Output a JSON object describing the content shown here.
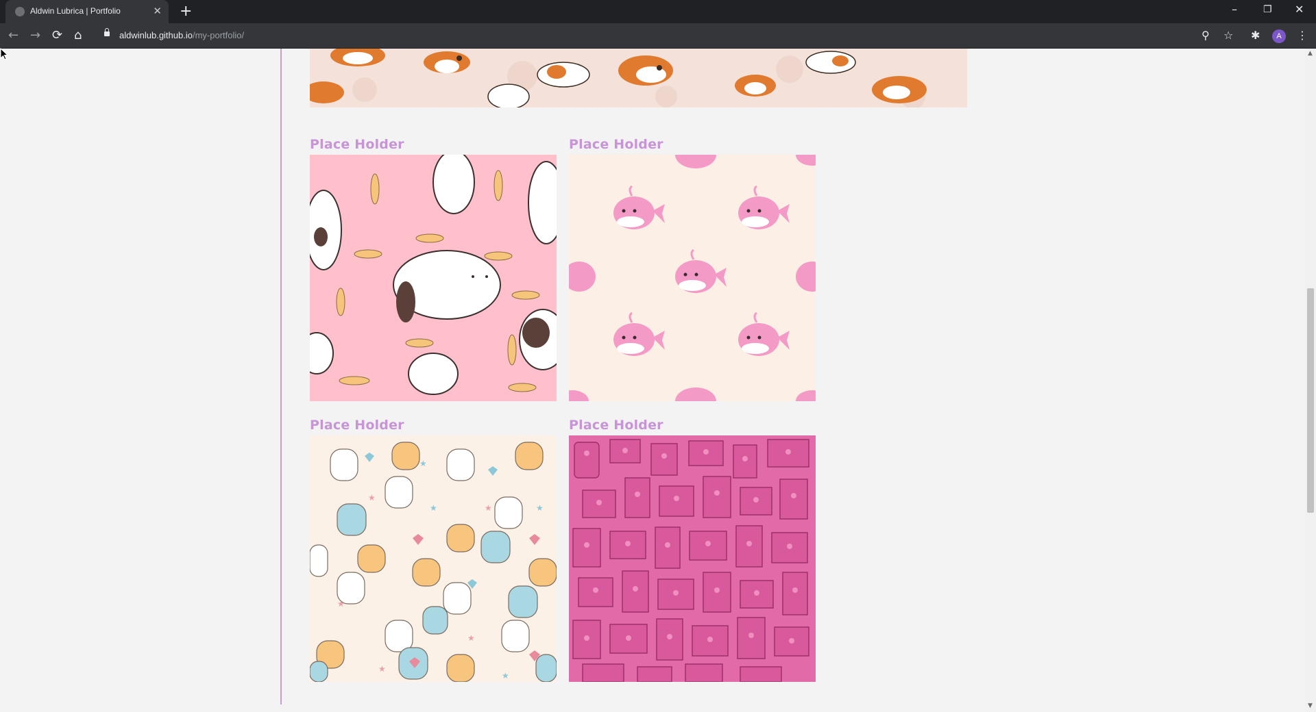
{
  "browser": {
    "tab_title": "Aldwin Lubrica | Portfolio",
    "tab_close": "✕",
    "new_tab": "+",
    "url_host": "aldwinlub.github.io",
    "url_path": "/my-portfolio/",
    "avatar_letter": "A",
    "icons": {
      "back": "←",
      "forward": "→",
      "reload": "⟳",
      "home": "⌂",
      "zoom": "⚲",
      "star": "☆",
      "extensions": "✱",
      "menu": "⋮",
      "minimize": "–",
      "restore": "❐",
      "close": "✕"
    }
  },
  "gallery": {
    "items": [
      {
        "caption": "Place Holder",
        "pattern": "cats-fish-on-pink"
      },
      {
        "caption": "Place Holder",
        "pattern": "pink-whales-on-cream"
      },
      {
        "caption": "Place Holder",
        "pattern": "kittens-hearts-stars"
      },
      {
        "caption": "Place Holder",
        "pattern": "pink-robots"
      }
    ]
  },
  "colors": {
    "accent_line": "#c79ad9",
    "caption": "#c794d6",
    "pink_bg": "#ffbfcb",
    "cream_bg": "#fcefe5",
    "kitten_bg": "#fbf1e7",
    "robot_bg": "#e26aa8"
  }
}
